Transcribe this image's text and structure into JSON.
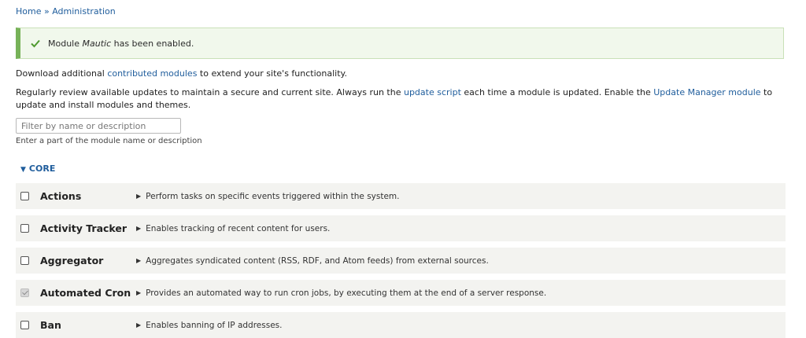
{
  "breadcrumb": {
    "home": "Home",
    "separator": "»",
    "current": "Administration"
  },
  "status_message": {
    "prefix": "Module ",
    "module": "Mautic",
    "suffix": " has been enabled."
  },
  "intro": {
    "line1_before": "Download additional ",
    "line1_link": "contributed modules",
    "line1_after": " to extend your site's functionality.",
    "line2_before": "Regularly review available updates to maintain a secure and current site. Always run the ",
    "line2_link1": "update script",
    "line2_middle": " each time a module is updated. Enable the ",
    "line2_link2": "Update Manager module",
    "line2_after": " to update and install modules and themes."
  },
  "filter": {
    "placeholder": "Filter by name or description",
    "value": "",
    "help": "Enter a part of the module name or description"
  },
  "group": {
    "label": "CORE",
    "expanded": true
  },
  "modules": [
    {
      "name": "Actions",
      "description": "Perform tasks on specific events triggered within the system.",
      "checked": false,
      "disabled": false
    },
    {
      "name": "Activity Tracker",
      "description": "Enables tracking of recent content for users.",
      "checked": false,
      "disabled": false
    },
    {
      "name": "Aggregator",
      "description": "Aggregates syndicated content (RSS, RDF, and Atom feeds) from external sources.",
      "checked": false,
      "disabled": false
    },
    {
      "name": "Automated Cron",
      "description": "Provides an automated way to run cron jobs, by executing them at the end of a server response.",
      "checked": true,
      "disabled": true
    },
    {
      "name": "Ban",
      "description": "Enables banning of IP addresses.",
      "checked": false,
      "disabled": false
    }
  ]
}
